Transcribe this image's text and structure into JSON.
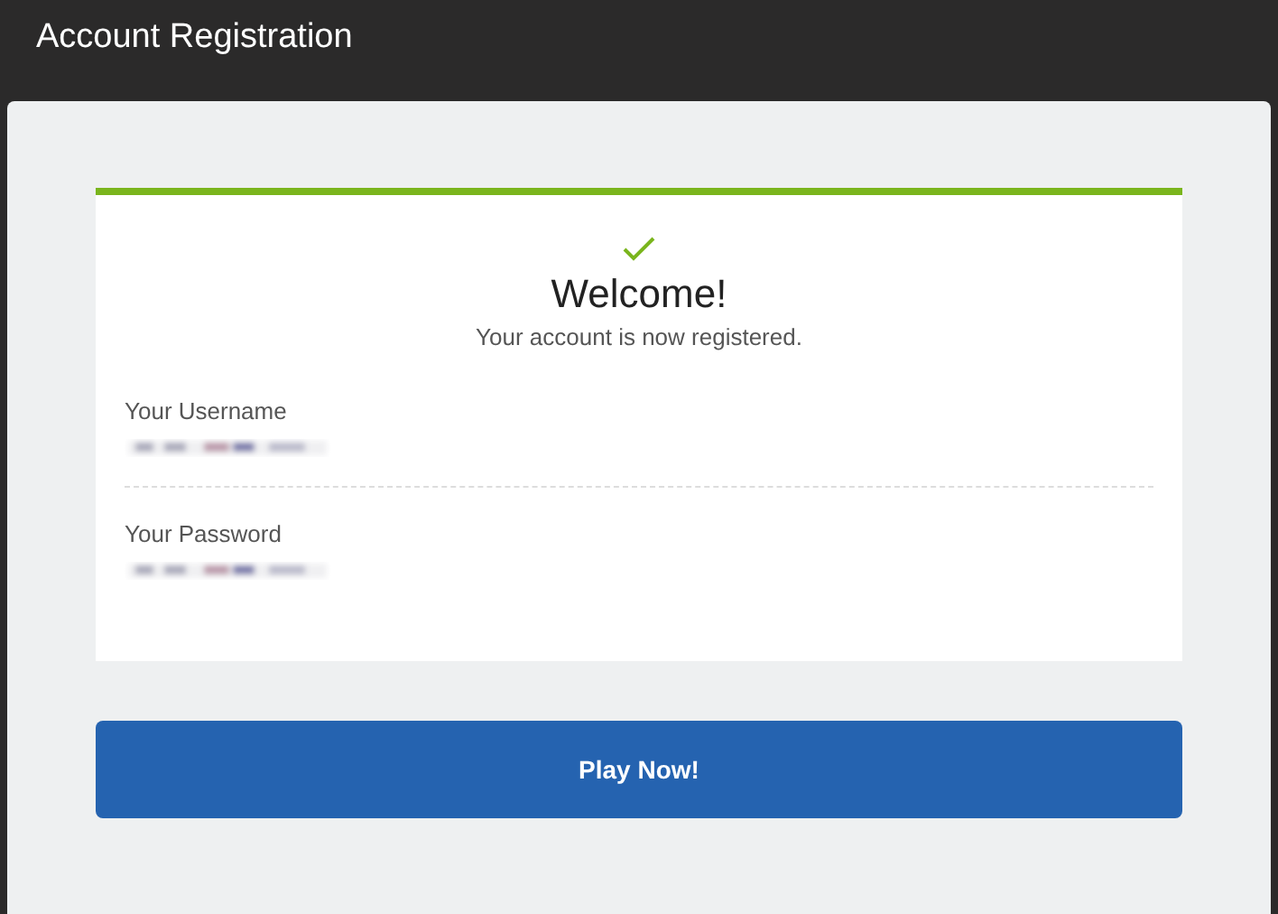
{
  "window": {
    "title": "Account Registration"
  },
  "card": {
    "heading": "Welcome!",
    "message": "Your account is now registered.",
    "fields": [
      {
        "label": "Your Username",
        "redacted": true
      },
      {
        "label": "Your Password",
        "redacted": true
      }
    ]
  },
  "button": {
    "label": "Play Now!"
  }
}
